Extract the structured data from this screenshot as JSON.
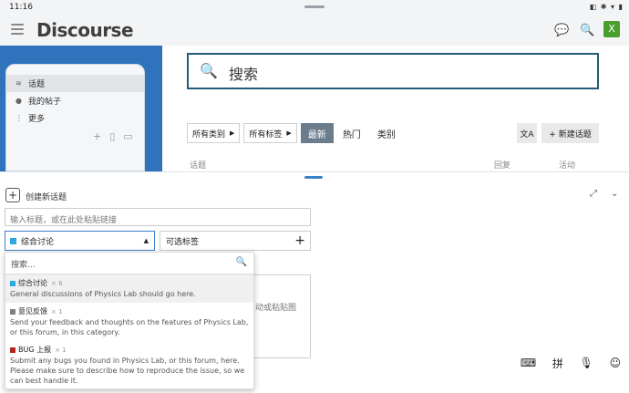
{
  "status": {
    "time": "11:16",
    "icons": "◧ ✱ ▾ ▮"
  },
  "header": {
    "logo": "Discourse",
    "avatar_letter": "X",
    "chat_icon": "chat-icon",
    "search_icon": "search-icon"
  },
  "sidebar": {
    "items": [
      {
        "label": "话题",
        "icon": "stack-icon"
      },
      {
        "label": "我的帖子",
        "icon": "user-icon"
      },
      {
        "label": "更多",
        "icon": "more-icon"
      }
    ]
  },
  "search": {
    "placeholder": "搜索"
  },
  "filters": {
    "category": "所有类别",
    "tags": "所有标签",
    "tabs": [
      "最新",
      "热门",
      "类别"
    ],
    "active_tab": "最新",
    "new_topic": "+ 新建话题"
  },
  "columns": {
    "topic": "话题",
    "replies": "回复",
    "activity": "活动"
  },
  "composer": {
    "heading": "创建新话题",
    "title_placeholder": "输入标题，或在此处粘贴链接",
    "category_selected": "综合讨论",
    "tags_placeholder": "可选标签",
    "editor_hint": "动或粘贴图",
    "dropdown": {
      "search_placeholder": "搜索...",
      "categories": [
        {
          "name": "综合讨论",
          "count": "× 6",
          "color": "#2ea8e0",
          "desc": "General discussions of Physics Lab should go here."
        },
        {
          "name": "意见反馈",
          "count": "× 1",
          "color": "#808281",
          "desc": "Send your feedback and thoughts on the features of Physics Lab, or this forum, in this category."
        },
        {
          "name": "BUG 上报",
          "count": "× 1",
          "color": "#b3261e",
          "desc": "Submit any bugs you found in Physics Lab, or this forum, here. Please make sure to describe how to reproduce the issue, so we can best handle it."
        }
      ]
    }
  },
  "keyboard": {
    "pinyin": "拼"
  }
}
